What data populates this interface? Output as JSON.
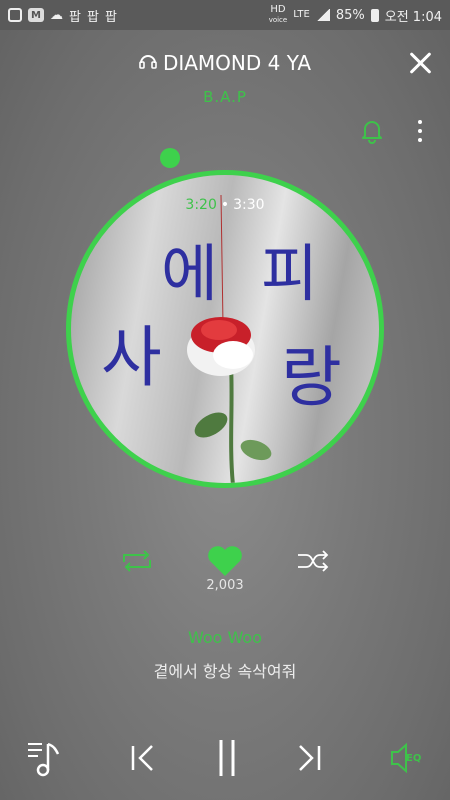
{
  "status_bar": {
    "network": "HD",
    "network_sub": "voice",
    "lte": "LTE",
    "battery": "85%",
    "time": "오전 1:04",
    "app_icons": [
      "팝",
      "팝",
      "팝"
    ]
  },
  "player": {
    "title": "DIAMOND 4 YA",
    "artist": "B.A.P",
    "time_current": "3:20",
    "time_separator": "•",
    "time_total": "3:30",
    "progress_fraction": 0.952,
    "likes": "2,003",
    "liked": true
  },
  "album_art": {
    "text_lines": [
      "에",
      "피",
      "사",
      "랑"
    ]
  },
  "lyrics": {
    "current": "Woo Woo",
    "next": "곁에서 항상 속삭여줘"
  },
  "controls": {
    "eq_label": "EQ"
  },
  "colors": {
    "accent": "#3ec24a",
    "ring": "#3ed14c",
    "text": "#ffffff",
    "background": "#7a7a7a"
  },
  "icons": [
    "headphone-icon",
    "close-icon",
    "bell-icon",
    "more-icon",
    "repeat-icon",
    "heart-icon",
    "shuffle-icon",
    "playlist-icon",
    "previous-icon",
    "pause-icon",
    "next-icon",
    "eq-icon"
  ]
}
